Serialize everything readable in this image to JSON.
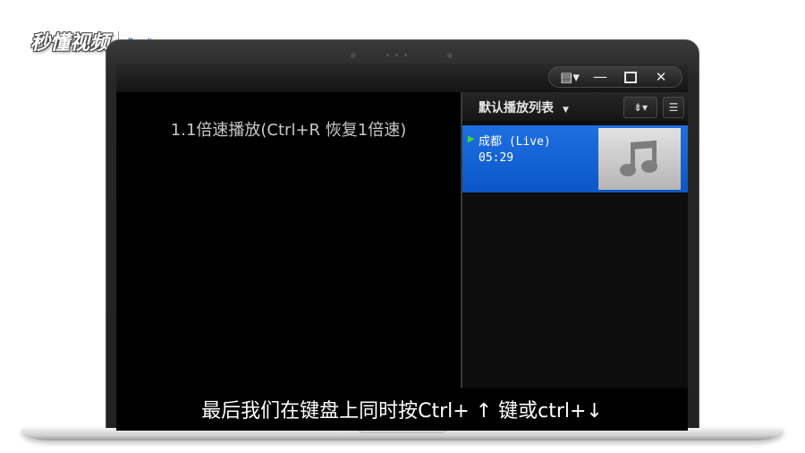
{
  "watermark": {
    "brand": "秒懂视频",
    "partner": "Peonling"
  },
  "window": {
    "controls": {
      "skin_icon": "▤▾",
      "minimize": "—",
      "close": "✕"
    }
  },
  "video": {
    "osd_text": "1.1倍速播放(Ctrl+R 恢复1倍速)"
  },
  "playlist": {
    "title": "默认播放列表",
    "title_caret": "▼",
    "sort_button": "⇟▾",
    "menu_button": "☰",
    "items": [
      {
        "name": "成都 (Live)",
        "duration": "05:29",
        "playing_indicator": "▶"
      }
    ]
  },
  "subtitle": "最后我们在键盘上同时按Ctrl+ ↑ 键或ctrl+↓"
}
